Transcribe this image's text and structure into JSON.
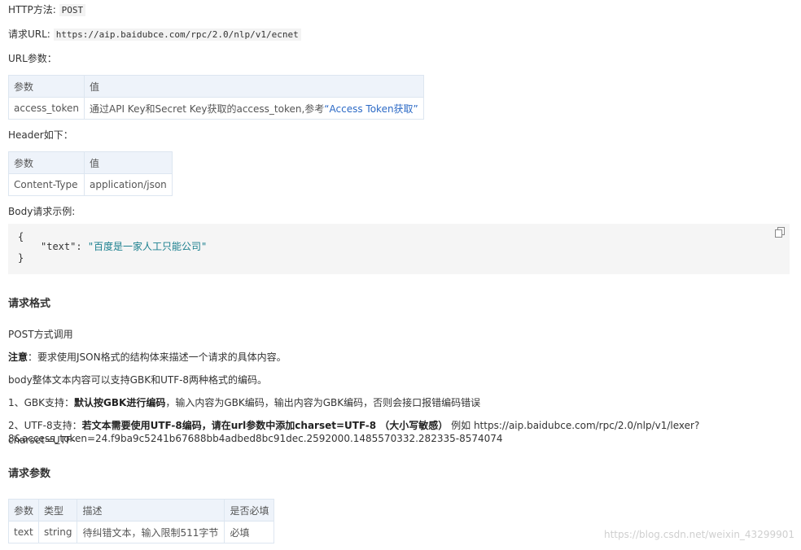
{
  "http_method": {
    "label": "HTTP方法:",
    "value": "POST"
  },
  "request_url": {
    "label": "请求URL:",
    "value": "https://aip.baidubce.com/rpc/2.0/nlp/v1/ecnet"
  },
  "url_params": {
    "title": "URL参数：",
    "headers": [
      "参数",
      "值"
    ],
    "row": {
      "param": "access_token",
      "value_text": "通过API Key和Secret Key获取的access_token,参考",
      "link_text": "“Access Token获取”"
    }
  },
  "header_params": {
    "title": "Header如下：",
    "headers": [
      "参数",
      "值"
    ],
    "row": {
      "param": "Content-Type",
      "value": "application/json"
    }
  },
  "body_example": {
    "title": "Body请求示例:",
    "open_brace": "{",
    "key": "\"text\"",
    "colon": ": ",
    "value": "\"百度是一家人工只能公司\"",
    "close_brace": "}"
  },
  "request_format": {
    "heading": "请求格式",
    "post_call": "POST方式调用",
    "note_label": "注意",
    "note_text": "：要求使用JSON格式的结构体来描述一个请求的具体内容。",
    "encoding_text": "body整体文本内容可以支持GBK和UTF-8两种格式的编码。",
    "gbk_prefix": "1、GBK支持：",
    "gbk_bold": "默认按GBK进行编码",
    "gbk_suffix": "，输入内容为GBK编码，输出内容为GBK编码，否则会接口报错编码错误",
    "utf8_prefix": "2、UTF-8支持：",
    "utf8_bold": "若文本需要使用UTF-8编码，请在url参数中添加charset=UTF-8 （大小写敏感）",
    "utf8_suffix_line1": " 例如 https://aip.baidubce.com/rpc/2.0/nlp/v1/lexer?charset=UTF-",
    "utf8_suffix_line2": "8&access_token=24.f9ba9c5241b67688bb4adbed8bc91dec.2592000.1485570332.282335-8574074"
  },
  "request_params": {
    "heading": "请求参数",
    "headers": [
      "参数",
      "类型",
      "描述",
      "是否必填"
    ],
    "row": [
      "text",
      "string",
      "待纠错文本，输入限制511字节",
      "必填"
    ]
  },
  "watermark": "https://blog.csdn.net/weixin_43299901"
}
